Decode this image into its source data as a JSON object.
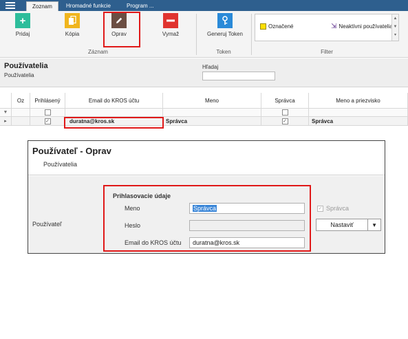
{
  "tabs": [
    {
      "label": "Zoznam"
    },
    {
      "label": "Hromadné funkcie"
    },
    {
      "label": "Program ..."
    }
  ],
  "ribbon": {
    "buttons": {
      "add": "Pridaj",
      "copy": "Kópia",
      "edit": "Oprav",
      "delete": "Vymaž",
      "token": "Generuj Token"
    },
    "groups": {
      "record": "Záznam",
      "token": "Token",
      "filter": "Filter"
    },
    "filter_items": {
      "marked": "Označené",
      "inactive": "Neaktívni používatelia"
    }
  },
  "header": {
    "title": "Používatelia",
    "subtitle": "Používatelia",
    "search_label": "Hľadaj"
  },
  "grid": {
    "columns": [
      "Oz",
      "Prihlásený",
      "Email do KROS účtu",
      "Meno",
      "Správca",
      "Meno a priezvisko"
    ],
    "row": {
      "email": "duratna@kros.sk",
      "name": "Správca",
      "full_name": "Správca"
    }
  },
  "dialog": {
    "title": "Používateľ - Oprav",
    "subtitle": "Používatelia",
    "side_label": "Používateľ",
    "section_title": "Prihlasovacie údaje",
    "name_label": "Meno",
    "name_value": "Správca",
    "password_label": "Heslo",
    "email_label": "Email do KROS účtu",
    "email_value": "duratna@kros.sk",
    "admin_label": "Správca",
    "set_button": "Nastaviť"
  },
  "colors": {
    "topbar": "#2e5f8e",
    "add_green": "#2dbd9b",
    "edit_brown": "#6b4e43",
    "delete_red": "#e0342f",
    "token_blue": "#2a8ad8",
    "highlight_red": "#e01818"
  }
}
